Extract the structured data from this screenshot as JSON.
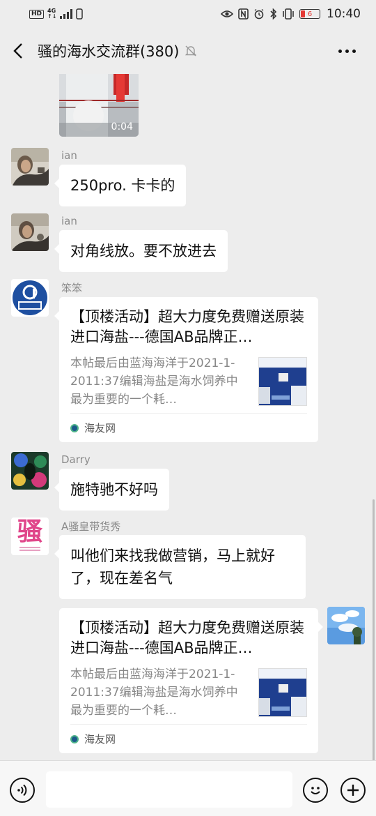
{
  "status_bar": {
    "hd": "HD",
    "net_top": "4G",
    "net_bottom": "↑↓",
    "battery_level": "6",
    "time": "10:40",
    "icons": [
      "eye-icon",
      "nfc-icon",
      "alarm-icon",
      "bluetooth-icon",
      "vibrate-icon"
    ]
  },
  "header": {
    "title": "骚的海水交流群(380)",
    "muted": true
  },
  "video": {
    "duration": "0:04"
  },
  "messages": [
    {
      "sender": "ian",
      "text": "250pro. 卡卡的"
    },
    {
      "sender": "ian",
      "text": "对角线放。要不放进去"
    },
    {
      "sender": "笨笨",
      "card": {
        "title": "【顶楼活动】超大力度免费赠送原装进口海盐---德国AB品牌正…",
        "desc": "本帖最后由蓝海海洋于2021-1-2011:37编辑海盐是海水饲养中最为重要的一个耗…",
        "source": "海友网"
      }
    },
    {
      "sender": "Darry",
      "text": "施特驰不好吗"
    },
    {
      "sender": "A骚皇带货秀",
      "text": "叫他们来找我做营销，马上就好了，现在差名气",
      "avatar_text": "骚"
    },
    {
      "sender": "me",
      "card": {
        "title": "【顶楼活动】超大力度免费赠送原装进口海盐---德国AB品牌正…",
        "desc": "本帖最后由蓝海海洋于2021-1-2011:37编辑海盐是海水饲养中最为重要的一个耗…",
        "source": "海友网"
      }
    }
  ],
  "input_bar": {
    "placeholder": "",
    "left_icon": "voice-icon",
    "right_icons": [
      "emoji-icon",
      "plus-icon"
    ]
  },
  "colors": {
    "background": "#ededed",
    "bubble": "#ffffff",
    "name_text": "#8a8a8a",
    "card_desc": "#888888"
  }
}
